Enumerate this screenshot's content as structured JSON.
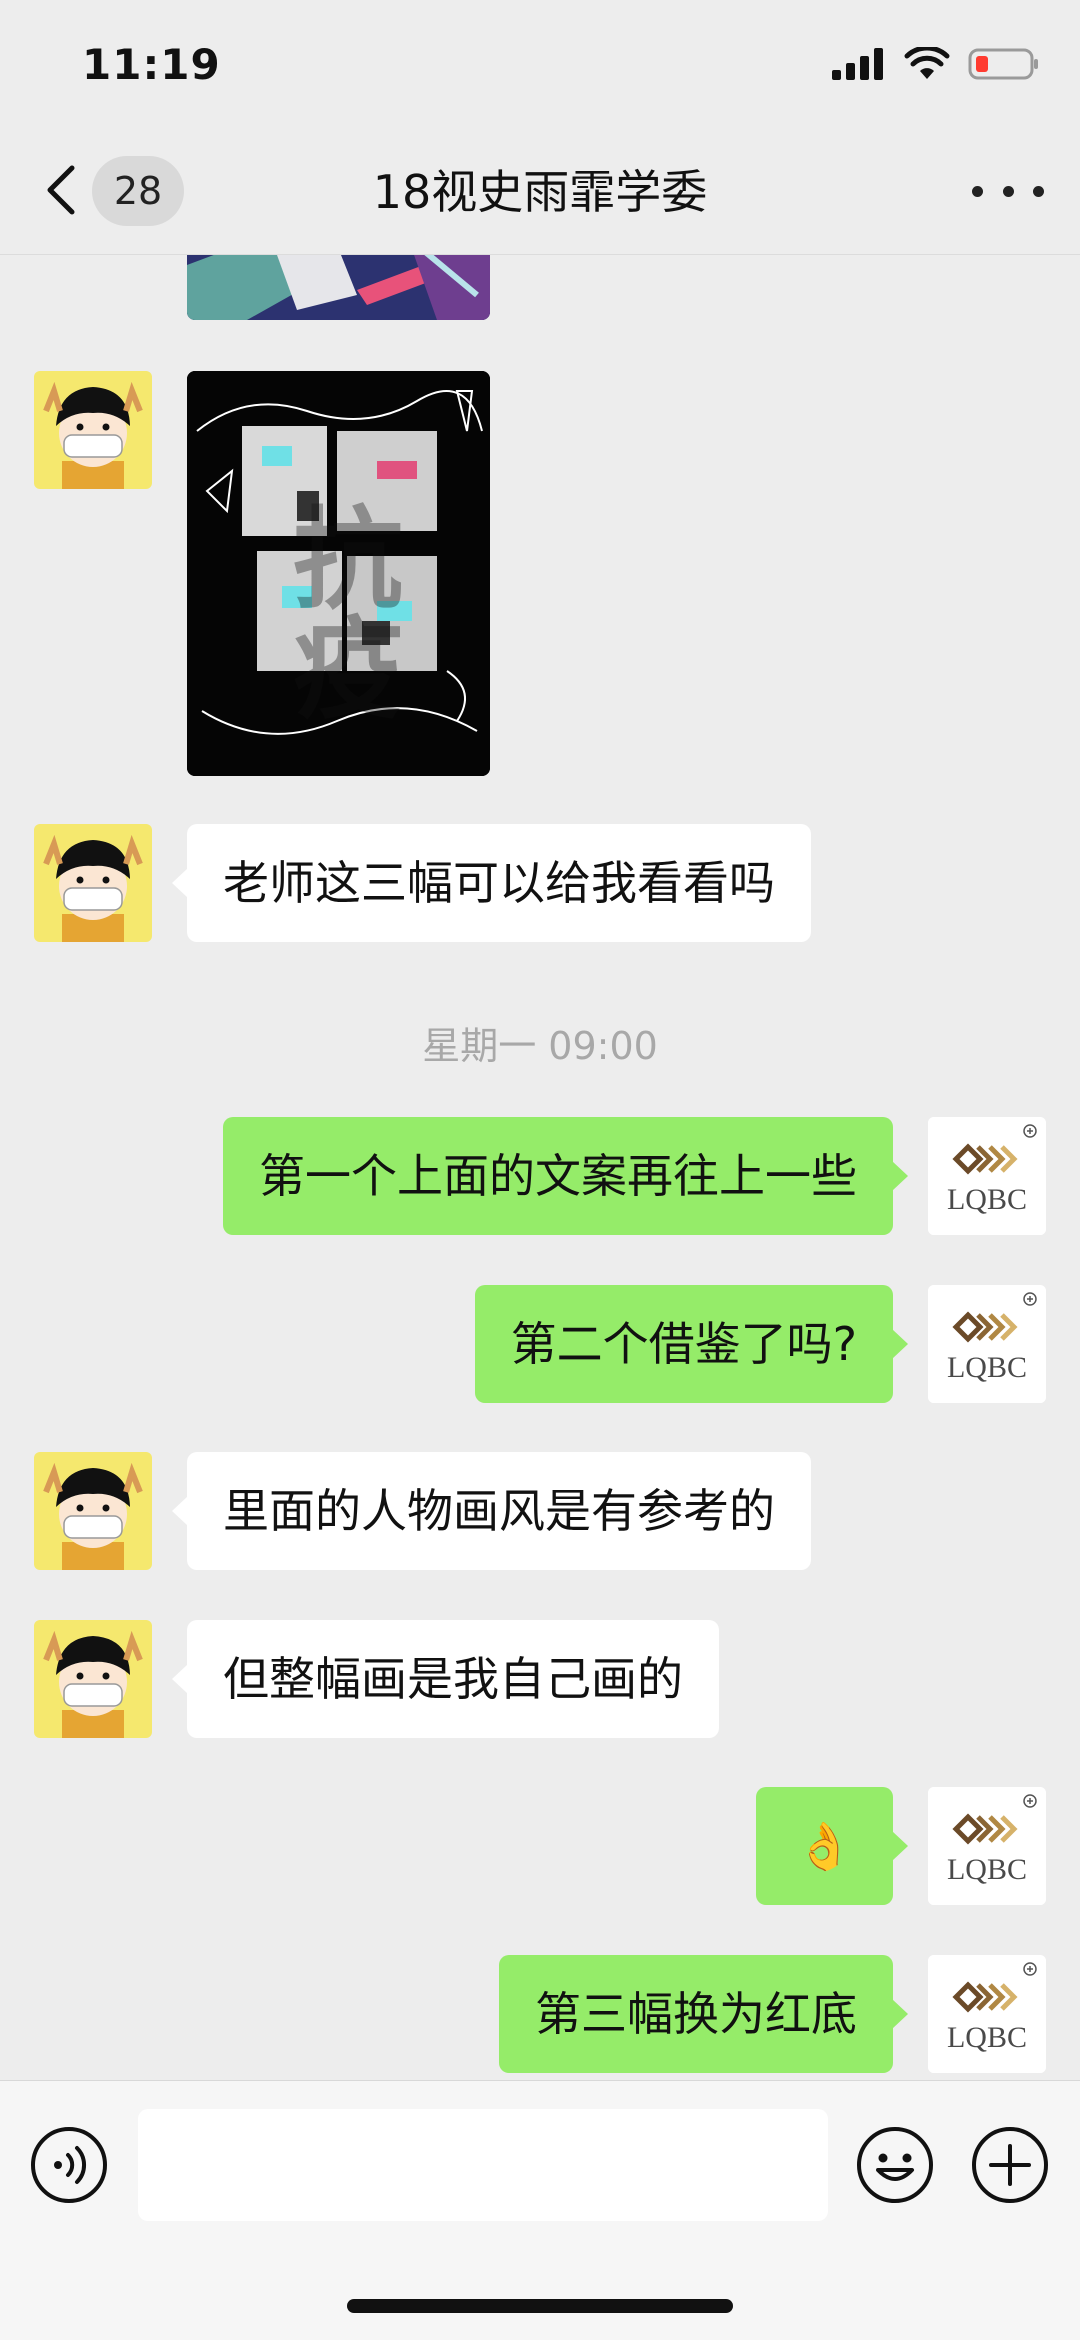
{
  "status_bar": {
    "time": "11:19"
  },
  "nav": {
    "unread_count": "28",
    "title": "18视史雨霏学委"
  },
  "messages": [
    {
      "text": "老师这三幅可以给我看看吗"
    },
    {
      "text": "第一个上面的文案再往上一些"
    },
    {
      "text": "第二个借鉴了吗?"
    },
    {
      "text": "里面的人物画风是有参考的"
    },
    {
      "text": "但整幅画是我自己画的"
    },
    {
      "text": "👌"
    },
    {
      "text": "第三幅换为红底"
    }
  ],
  "timestamp": "星期一 09:00",
  "poster": {
    "text": "抗疫"
  },
  "logo": {
    "text": "LQBC"
  },
  "colors": {
    "accent_green": "#95ec69",
    "background": "#ededed"
  },
  "icons": [
    "signal-icon",
    "wifi-icon",
    "battery-icon",
    "back-icon",
    "more-icon",
    "voice-icon",
    "emoji-icon",
    "plus-icon"
  ]
}
